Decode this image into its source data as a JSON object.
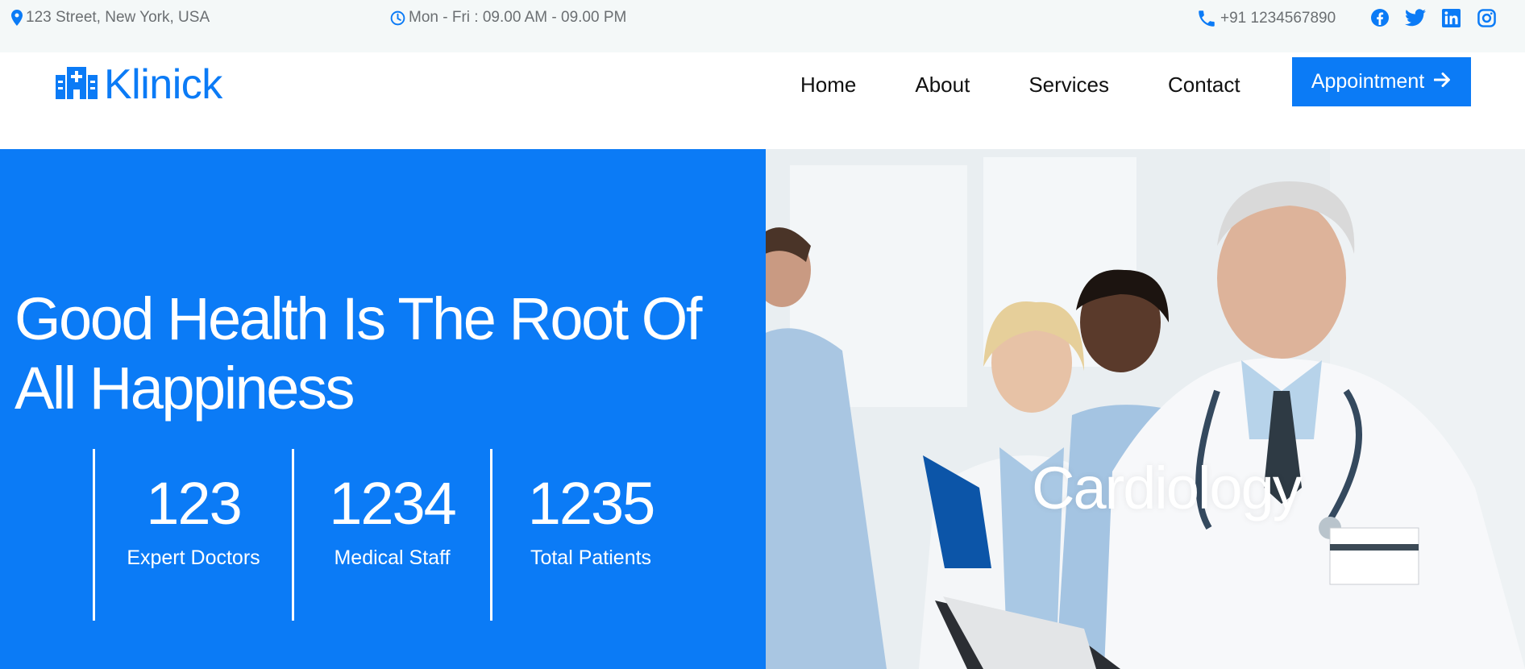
{
  "topbar": {
    "address": "123 Street, New York, USA",
    "hours": "Mon - Fri : 09.00 AM - 09.00 PM",
    "phone": "+91 1234567890",
    "socials": [
      "facebook-icon",
      "twitter-icon",
      "linkedin-icon",
      "instagram-icon"
    ],
    "icon_color": "#0b7bf6"
  },
  "navbar": {
    "brand": "Klinick",
    "menu": [
      "Home",
      "About",
      "Services",
      "Contact"
    ],
    "cta_label": "Appointment"
  },
  "hero": {
    "title_line1": "Good Health Is The Root Of",
    "title_line2": "All Happiness",
    "stats": [
      {
        "value": "123",
        "label": "Expert Doctors"
      },
      {
        "value": "1234",
        "label": "Medical Staff"
      },
      {
        "value": "1235",
        "label": "Total Patients"
      }
    ],
    "slide_caption": "Cardiology"
  },
  "colors": {
    "primary": "#0b7bf6",
    "topbar_bg": "#f4f8f8"
  }
}
